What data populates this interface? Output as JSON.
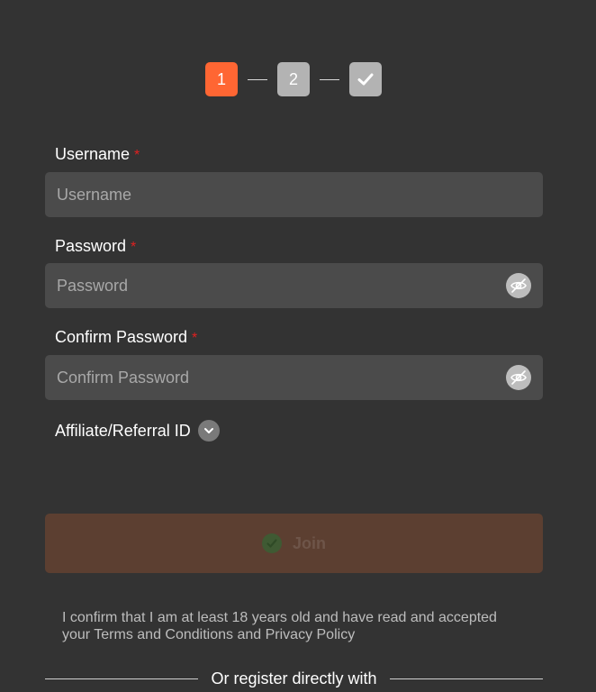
{
  "stepper": {
    "step1": "1",
    "step2": "2",
    "step3_icon": "check-icon",
    "active_color": "#ff6633",
    "pending_color": "#b3b3b3"
  },
  "form": {
    "username": {
      "label": "Username",
      "required": "*",
      "placeholder": "Username",
      "value": ""
    },
    "password": {
      "label": "Password",
      "required": "*",
      "placeholder": "Password",
      "value": "",
      "toggle_icon": "eye-off-icon"
    },
    "confirm_password": {
      "label": "Confirm Password",
      "required": "*",
      "placeholder": "Confirm Password",
      "value": "",
      "toggle_icon": "eye-off-icon"
    },
    "affiliate": {
      "label": "Affiliate/Referral ID",
      "icon": "chevron-down-icon"
    }
  },
  "join_button": {
    "label": "Join",
    "icon": "check-circle-icon",
    "state": "disabled"
  },
  "terms_text": "I confirm that I am at least 18 years old and have read and accepted your Terms and Conditions and Privacy Policy",
  "divider_text": "Or register directly with"
}
